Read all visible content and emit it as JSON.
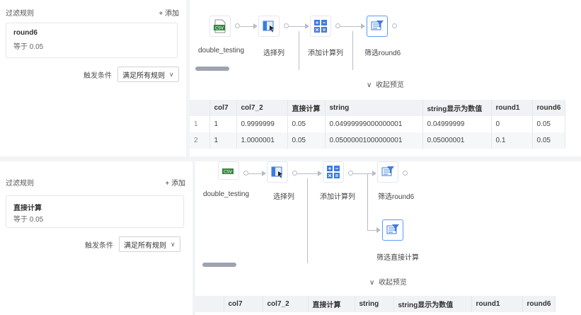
{
  "top": {
    "rules_title": "过滤规则",
    "add_label": "+ 添加",
    "rule": {
      "name": "round6",
      "condition": "等于 0.05"
    },
    "trigger_label": "触发条件",
    "trigger_value": "满足所有规则",
    "nodes": [
      "double_testing",
      "选择列",
      "添加计算列",
      "筛选round6"
    ],
    "preview_toggle": "收起预览",
    "columns": [
      "col7",
      "col7_2",
      "直接计算",
      "string",
      "string显示为数值",
      "round1",
      "round6"
    ],
    "rows": [
      [
        "1",
        "1",
        "0.9999999",
        "0.05",
        "0.04999999000000001",
        "0.04999999",
        "0",
        "0.05"
      ],
      [
        "2",
        "1",
        "1.0000001",
        "0.05",
        "0.05000001000000001",
        "0.05000001",
        "0.1",
        "0.05"
      ]
    ]
  },
  "bottom": {
    "rules_title": "过滤规则",
    "add_label": "+ 添加",
    "rule": {
      "name": "直接计算",
      "condition": "等于 0.05"
    },
    "trigger_label": "触发条件",
    "trigger_value": "满足所有规则",
    "nodes": [
      "double_testing",
      "选择列",
      "添加计算列",
      "筛选round6",
      "筛选直接计算"
    ],
    "preview_toggle": "收起预览",
    "columns": [
      "col7",
      "col7_2",
      "直接计算",
      "string",
      "string显示为数值",
      "round1",
      "round6"
    ]
  },
  "icons": {
    "csv": "csv-icon",
    "select": "select-columns-icon",
    "calc": "calculator-icon",
    "filter": "filter-icon",
    "chevron": "chevron-down-icon"
  },
  "colors": {
    "csv_green": "#2e8b3a",
    "calc_blue": "#3a7be0",
    "selected_border": "#5b9bf8"
  }
}
